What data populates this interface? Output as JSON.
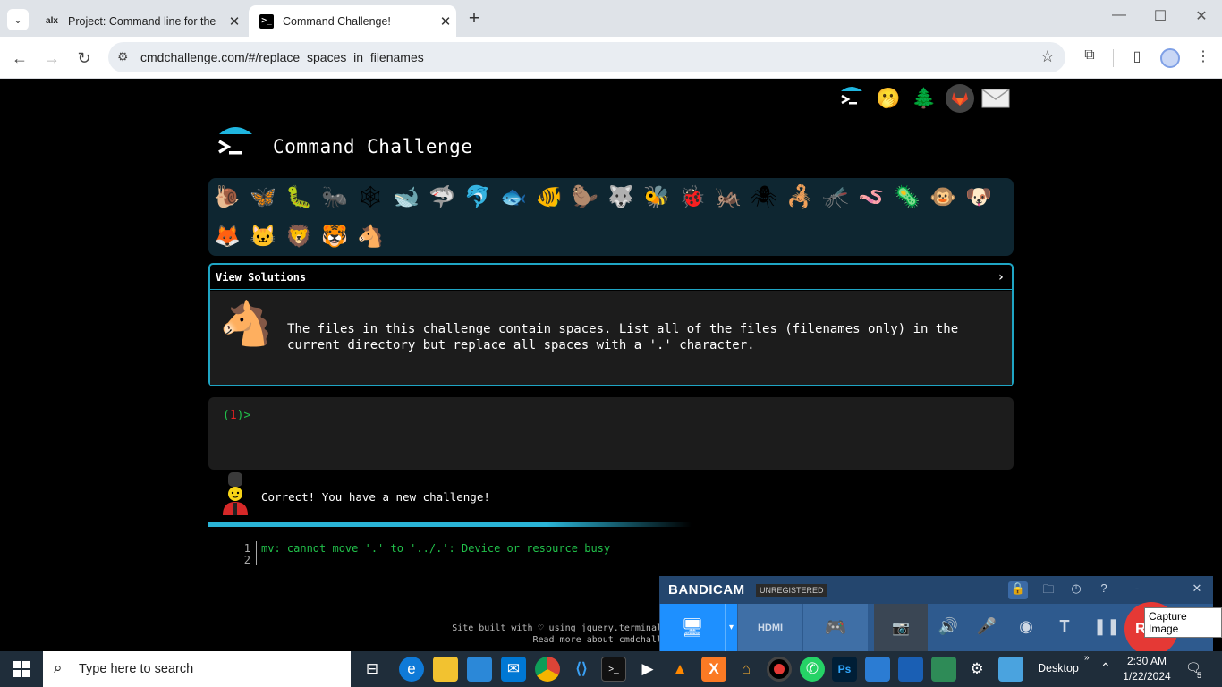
{
  "browser": {
    "tabs": [
      {
        "title": "Project: Command line for the",
        "favicon": "alx",
        "active": false
      },
      {
        "title": "Command Challenge!",
        "favicon": "terminal-icon",
        "active": true
      }
    ],
    "new_tab": "+",
    "url": "cmdchallenge.com/#/replace_spaces_in_filenames"
  },
  "site": {
    "title": "Command Challenge",
    "top_icons": [
      "terminal-icon",
      "emoji-icon",
      "tree-icon",
      "gitlab-icon",
      "mail-icon"
    ],
    "animals_row1": [
      "🐌",
      "🦋",
      "🐛",
      "🐜",
      "🕸",
      "🐋",
      "🦈",
      "🐬",
      "🐟",
      "🐠",
      "🦫",
      "🐺",
      "🐝",
      "🐞",
      "🦗",
      "🕷",
      "🦂",
      "🦟",
      "🪱",
      "🦠",
      "🐵",
      "🐶"
    ],
    "animals_row2": [
      "🦊",
      "🐱",
      "🦁",
      "🐯",
      "🐴"
    ],
    "solutions": {
      "header": "View Solutions",
      "chevron": "›",
      "challenge_icon": "🐴",
      "description": "The files in this challenge contain spaces. List all of the files (filenames only) in the current directory but replace all spaces with a '.' character."
    },
    "terminal": {
      "prompt_open": "(",
      "prompt_num": "1",
      "prompt_close": ")>"
    },
    "feedback": "Correct! You have a new challenge!",
    "output": {
      "lines": [
        {
          "num": "1",
          "text": "mv: cannot move '.' to '../.': Device or resource busy"
        },
        {
          "num": "2",
          "text": ""
        }
      ]
    },
    "footer": {
      "line1": "Site built with ♡ using jquery.terminal",
      "line2": "Read more about cmdchall"
    }
  },
  "bandicam": {
    "brand": "BANDICAM",
    "badge": "UNREGISTERED",
    "rec": "REC",
    "tooltip": "Capture Image"
  },
  "taskbar": {
    "search_placeholder": "Type here to search",
    "desktop": "Desktop",
    "time": "2:30 AM",
    "date": "1/22/2024",
    "notifications": "5"
  }
}
